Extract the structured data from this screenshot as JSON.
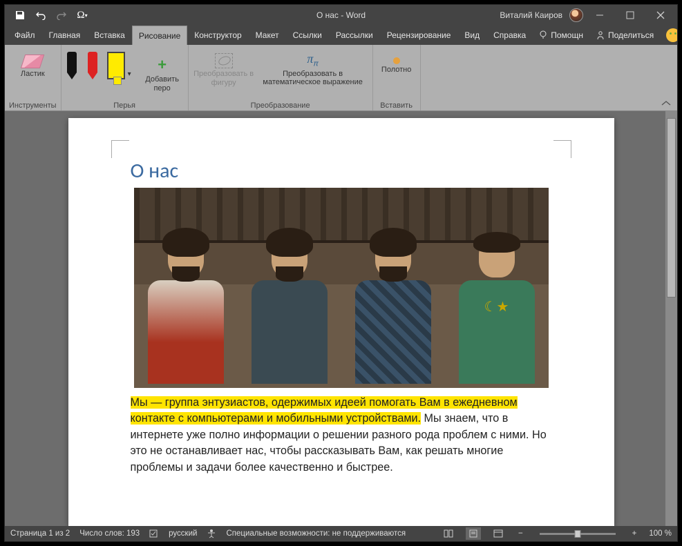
{
  "titlebar": {
    "doc_title": "О нас  -  Word",
    "user": "Виталий Каиров"
  },
  "menus": {
    "file": "Файл",
    "home": "Главная",
    "insert": "Вставка",
    "draw": "Рисование",
    "design": "Конструктор",
    "layout": "Макет",
    "references": "Ссылки",
    "mailings": "Рассылки",
    "review": "Рецензирование",
    "view": "Вид",
    "help": "Справка",
    "tell_me": "Помощн",
    "share": "Поделиться"
  },
  "ribbon": {
    "eraser": "Ластик",
    "tools_group": "Инструменты",
    "add_pen": "Добавить перо",
    "pens_group": "Перья",
    "to_shape": "Преобразовать в фигуру",
    "to_math": "Преобразовать в математическое выражение",
    "transform_group": "Преобразование",
    "canvas": "Полотно",
    "insert_group": "Вставить"
  },
  "document": {
    "heading": "О нас",
    "highlighted": "Мы — группа энтузиастов, одержимых идеей помогать Вам в ежедневном контакте с компьютерами и мобильными устройствами.",
    "rest": " Мы знаем, что в интернете уже полно информации о решении разного рода проблем с ними. Но это не останавливает нас, чтобы рассказывать Вам, как решать многие проблемы и задачи более качественно и быстрее."
  },
  "status": {
    "page": "Страница 1 из 2",
    "words": "Число слов: 193",
    "lang": "русский",
    "a11y": "Специальные возможности: не поддерживаются",
    "zoom": "100 %"
  }
}
